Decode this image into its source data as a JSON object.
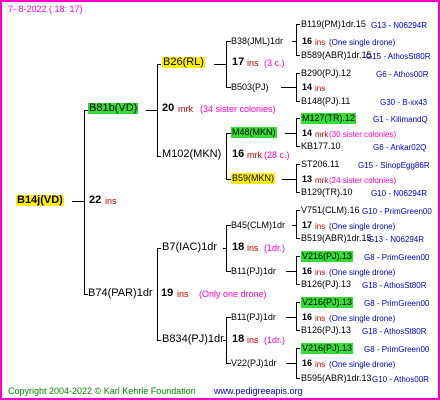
{
  "header": {
    "date": "7-  8-2022 ( 18: 17)"
  },
  "root": {
    "name": "B14j(VD)",
    "year": "22",
    "unit": "ins"
  },
  "gen1": {
    "top": {
      "name": "B81b(VD)"
    },
    "bottom": {
      "name": "B74(PAR)1dr",
      "year": "19",
      "unit": "ins",
      "note": "(Only one drone)"
    }
  },
  "gen2": {
    "a": {
      "name": "B26(RL)",
      "year": "17",
      "unit": "ins",
      "note": "(3 c.)"
    },
    "b": {
      "name": "M102(MKN)",
      "year": "20",
      "unit": "mrk",
      "note": "(34 sister colonies)",
      "year2": "16",
      "unit2": "mrk",
      "note2": "(28 c.)"
    },
    "c": {
      "name": "B7(IAC)1dr",
      "year": "18",
      "unit": "ins",
      "note": "(1dr.)"
    },
    "d": {
      "name": "B834(PJ)1dr",
      "year": "18",
      "unit": "ins",
      "note": "(1dr.)"
    }
  },
  "gen3": {
    "a1": {
      "name": "B38(JML)1dr",
      "year": "16",
      "unit": "ins",
      "note": "(One single drone)"
    },
    "a2": {
      "name": "B503(PJ)",
      "year": "14",
      "unit": "ins"
    },
    "b1": {
      "name": "M48(MKN)",
      "year": "14",
      "unit": "mrk",
      "note": "(30 sister colonies)"
    },
    "b2": {
      "name": "B59(MKN)",
      "year": "13",
      "unit": "mrk",
      "note": "(24 sister colonies)"
    },
    "c1": {
      "name": "B45(CLM)1dr",
      "year": "17",
      "unit": "ins",
      "note": "(One single drone)"
    },
    "c2": {
      "name": "B11(PJ)1dr",
      "year": "16",
      "unit": "ins",
      "note": "(One single drone)"
    },
    "d1": {
      "name": "B11(PJ)1dr",
      "year": "16",
      "unit": "ins",
      "note": "(One single drone)"
    },
    "d2": {
      "name": "V22(PJ)1dr",
      "year": "16",
      "unit": "ins",
      "note": "(One single drone)"
    }
  },
  "gen4": [
    {
      "name": "B119(PM)1dr.15",
      "code": "G13 - N06294R"
    },
    {
      "name": "B589(ABR)1dr.15",
      "code": "G15 - AthosSt80R"
    },
    {
      "name": "B290(PJ).12",
      "code": "G6 - Athos00R"
    },
    {
      "name": "B148(PJ).11",
      "code": "G30 - B-xx43"
    },
    {
      "name": "M127(TR).12",
      "code": "G1 - KilimandQ"
    },
    {
      "name": "KB177.10",
      "code": "G6 - Ankar02Q"
    },
    {
      "name": "ST206.11",
      "code": "G15 - SinopEgg86R"
    },
    {
      "name": "B129(TR).10",
      "code": "G10 - N06294R"
    },
    {
      "name": "V751(CLM).16",
      "code": "G10 - PrimGreen00"
    },
    {
      "name": "B519(ABR)1dr.15",
      "code": "G13 - N06294R"
    },
    {
      "name": "V216(PJ).13",
      "code": "G8 - PrimGreen00"
    },
    {
      "name": "B126(PJ).13",
      "code": "G18 - AthosSt80R"
    },
    {
      "name": "V216(PJ).13",
      "code": "G8 - PrimGreen00"
    },
    {
      "name": "B126(PJ).13",
      "code": "G18 - AthosSt80R"
    },
    {
      "name": "V216(PJ).13",
      "code": "G8 - PrimGreen00"
    },
    {
      "name": "B595(ABR)1dr.13",
      "code": "G10 - Athos00R"
    }
  ],
  "footer": {
    "copyright": "Copyright 2004-2022 © Karl Kehrle Foundation",
    "url": "www.pedigreeapis.org"
  }
}
